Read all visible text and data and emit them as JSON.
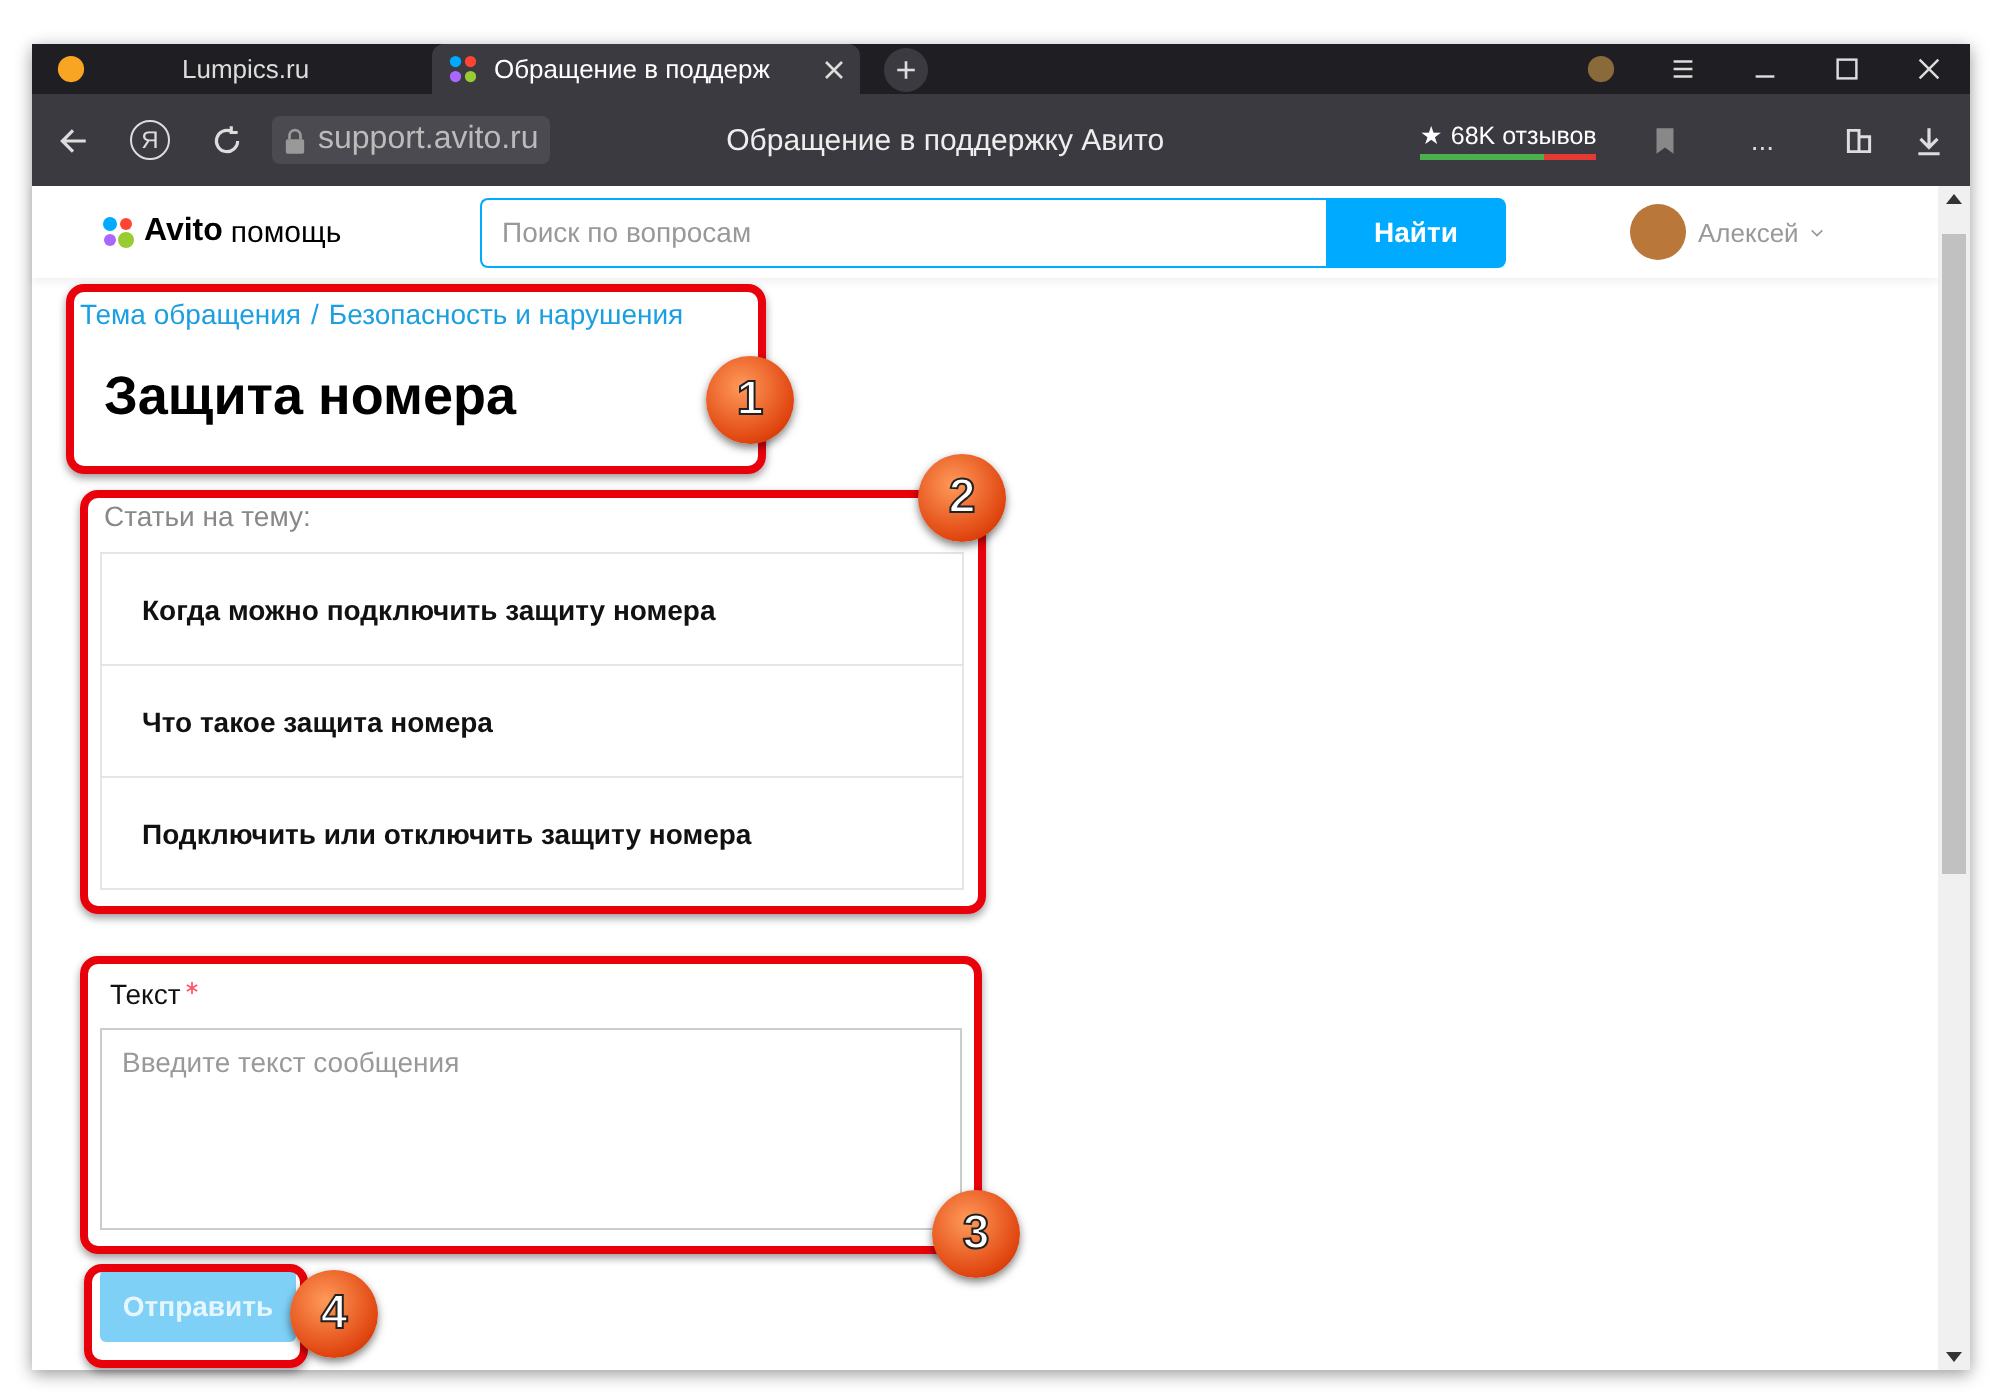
{
  "browser": {
    "tabs": [
      {
        "title": "Lumpics.ru",
        "selected": false
      },
      {
        "title": "Обращение в поддерж",
        "selected": true
      }
    ],
    "new_tab": "+",
    "address": "support.avito.ru",
    "page_title": "Обращение в поддержку Авито",
    "yandex_button": "Я",
    "reviews": "★ 68K отзывов",
    "menu": "..."
  },
  "site_header": {
    "logo": "Avito",
    "logo_suffix": "помощь",
    "search": {
      "placeholder": "Поиск по вопросам"
    },
    "search_button": "Найти",
    "user": "Алексей"
  },
  "breadcrumbs": [
    "Тема обращения",
    "Безопасность и нарушения"
  ],
  "breadcrumb_separator": "/",
  "title": "Защита номера",
  "articles_label": "Статьи на тему:",
  "articles": [
    "Когда можно подключить защиту номера",
    "Что такое защита номера",
    "Подключить или отключить защиту номера"
  ],
  "text_field": {
    "label": "Текст",
    "required": true,
    "placeholder": "Введите текст сообщения"
  },
  "submit": {
    "label": "Отправить",
    "disabled": true
  },
  "annotations": [
    {
      "number": "1"
    },
    {
      "number": "2"
    },
    {
      "number": "3"
    },
    {
      "number": "4"
    }
  ]
}
